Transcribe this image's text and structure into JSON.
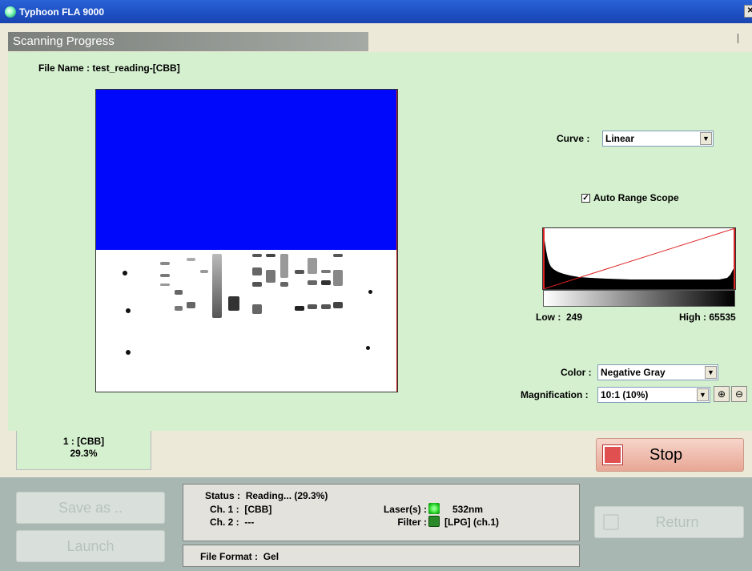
{
  "app": {
    "title": "Typhoon FLA 9000",
    "section": "Scanning Progress"
  },
  "file": {
    "label": "File Name :",
    "value": "test_reading-[CBB]"
  },
  "curve": {
    "label": "Curve :",
    "value": "Linear"
  },
  "auto_range": {
    "label": "Auto Range Scope",
    "checked": true
  },
  "range": {
    "low_label": "Low :",
    "low": "249",
    "high_label": "High :",
    "high": "65535"
  },
  "color": {
    "label": "Color :",
    "value": "Negative Gray"
  },
  "magnification": {
    "label": "Magnification :",
    "value": "10:1 (10%)"
  },
  "tab": {
    "name": "1 : [CBB]",
    "progress": "29.3%"
  },
  "buttons": {
    "stop": "Stop",
    "save_as": "Save as ..",
    "launch": "Launch",
    "return": "Return"
  },
  "status": {
    "status_label": "Status :",
    "status_value": "Reading... (29.3%)",
    "ch1_label": "Ch. 1 :",
    "ch1_value": "[CBB]",
    "ch2_label": "Ch. 2 :",
    "ch2_value": "---",
    "laser_label": "Laser(s) :",
    "laser_value": "532nm",
    "laser_color": "#22cc22",
    "filter_label": "Filter :",
    "filter_value": "[LPG] (ch.1)",
    "filter_color": "#2a8a2a"
  },
  "file_format": {
    "label": "File Format :",
    "value": "Gel"
  },
  "icons": {
    "zoom_in": "zoom-in-icon",
    "zoom_out": "zoom-out-icon",
    "dropdown": "chevron-down-icon"
  },
  "colors": {
    "panel": "#d5f0cf",
    "scan_blue": "#0008fb",
    "stop_red": "#e05050"
  }
}
